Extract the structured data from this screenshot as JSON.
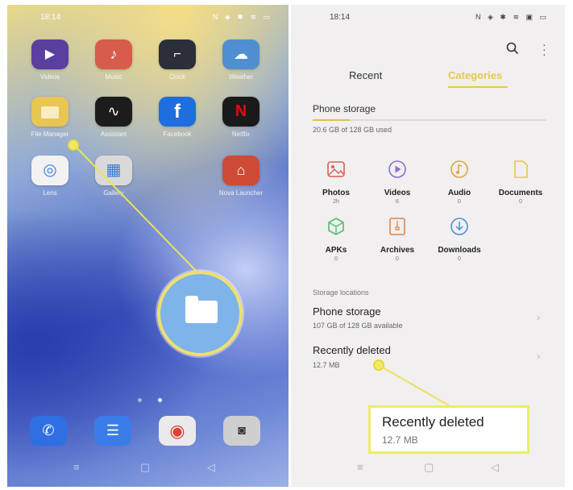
{
  "left_phone": {
    "status_time": "18:14",
    "status_icons": "N ◈ ✱ ≋ ▭",
    "apps_row1": [
      {
        "name": "Videos",
        "color": "#5a3f9f",
        "glyph": "▶"
      },
      {
        "name": "Music",
        "color": "#d65c4b",
        "glyph": "♪"
      },
      {
        "name": "Clock",
        "color": "#2b2f3a",
        "glyph": "⌐"
      },
      {
        "name": "Weather",
        "color": "#4f8fd1",
        "glyph": "☁"
      }
    ],
    "apps_row2": [
      {
        "name": "File Manager",
        "color": "#e8c654",
        "glyph": "▬"
      },
      {
        "name": "Assistant",
        "color": "#1c1c1c",
        "glyph": "∿"
      },
      {
        "name": "Facebook",
        "color": "#1e6ee0",
        "glyph": "f"
      },
      {
        "name": "Netflix",
        "color": "#1a1a1a",
        "glyph": "N"
      }
    ],
    "apps_row3": [
      {
        "name": "Lens",
        "color": "#f2f2f2",
        "glyph": "◎"
      },
      {
        "name": "Gallery",
        "color": "#d9d9d9",
        "glyph": "▦"
      },
      {
        "name": "Nova Launcher",
        "color": "#cf4a35",
        "glyph": "⌂"
      }
    ],
    "nav_icons": [
      "≡",
      "▢",
      "◁"
    ]
  },
  "right_phone": {
    "status_time": "18:14",
    "status_icons": "N ◈ ✱ ≋ ▣ ▭",
    "tabs": {
      "recent": "Recent",
      "categories": "Categories"
    },
    "phone_storage": {
      "title": "Phone storage",
      "used": "20.6 GB of 128 GB used",
      "fill_fraction": 0.16
    },
    "categories": [
      {
        "label": "Photos",
        "count": "2h",
        "color": "#d9625a"
      },
      {
        "label": "Videos",
        "count": "6",
        "color": "#8a6fd1"
      },
      {
        "label": "Audio",
        "count": "0",
        "color": "#e2a43a"
      },
      {
        "label": "Documents",
        "count": "0",
        "color": "#e8c84a"
      },
      {
        "label": "APKs",
        "count": "0",
        "color": "#4fbf73"
      },
      {
        "label": "Archives",
        "count": "0",
        "color": "#d9864a"
      },
      {
        "label": "Downloads",
        "count": "0",
        "color": "#4a90d9"
      }
    ],
    "storage_locations_title": "Storage locations",
    "rows": [
      {
        "title": "Phone storage",
        "sub": "107 GB of 128 GB available"
      },
      {
        "title": "Recently deleted",
        "sub": "12.7 MB"
      }
    ],
    "callout": {
      "title": "Recently deleted",
      "sub": "12.7 MB"
    },
    "nav_icons": [
      "≡",
      "▢",
      "◁"
    ]
  },
  "colors": {
    "accent": "#e8c84a",
    "highlight": "#eee06a"
  }
}
